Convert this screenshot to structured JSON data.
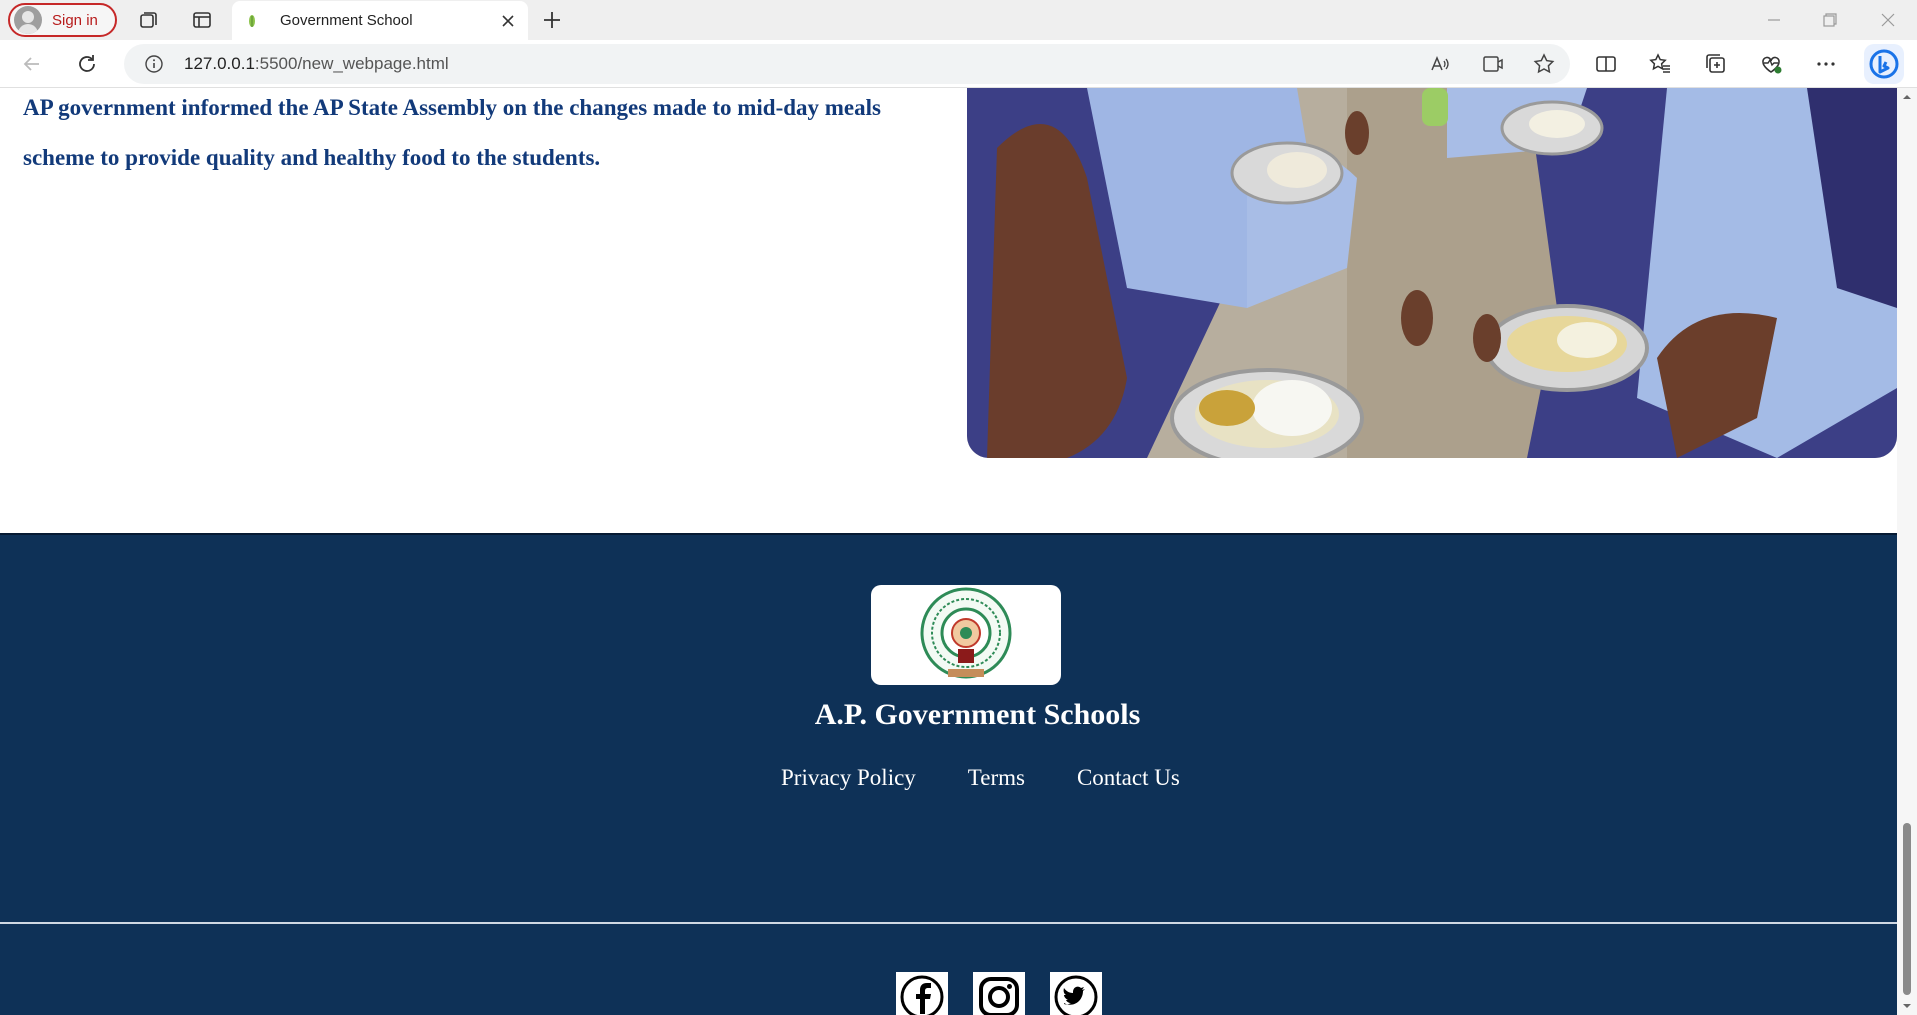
{
  "browser": {
    "sign_in_label": "Sign in",
    "tab_title": "Government School",
    "url_host": "127.0.0.1",
    "url_path": ":5500/new_webpage.html"
  },
  "article": {
    "paragraph": "AP government informed the AP State Assembly on the changes made to mid-day meals scheme to provide quality and healthy food to the students."
  },
  "footer": {
    "title": "A.P. Government Schools",
    "links": [
      "Privacy Policy",
      "Terms",
      "Contact Us"
    ],
    "social_icons": [
      "facebook-icon",
      "instagram-icon",
      "twitter-icon"
    ],
    "background_color": "#0e3157"
  },
  "colors": {
    "article_text": "#123a7a",
    "signin_border": "#c62828"
  }
}
